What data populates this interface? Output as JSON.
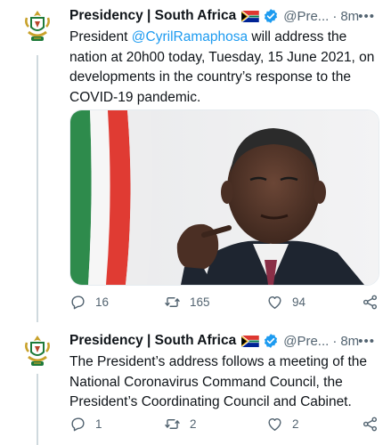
{
  "tweets": [
    {
      "author_name": "Presidency | South Africa",
      "handle": "@Pre...",
      "separator": "·",
      "time": "8m",
      "text_before": "President ",
      "mention": "@CyrilRamaphosa",
      "text_after": " will address the nation at 20h00 today, Tuesday, 15 June 2021, on developments in the country’s response to the COVID-19 pandemic.",
      "stats": {
        "replies": "16",
        "retweets": "165",
        "likes": "94"
      }
    },
    {
      "author_name": "Presidency | South Africa",
      "handle": "@Pre...",
      "separator": "·",
      "time": "8m",
      "text": "The President’s address follows a meeting of the National Coronavirus Command Council, the President’s Coordinating Council and Cabinet.",
      "stats": {
        "replies": "1",
        "retweets": "2",
        "likes": "2"
      }
    }
  ],
  "icons": [
    "coat-of-arms-icon",
    "south-africa-flag-icon",
    "verified-badge-icon",
    "more-options-icon",
    "reply-icon",
    "retweet-icon",
    "like-icon",
    "share-icon"
  ],
  "colors": {
    "accent": "#1d9bf0",
    "secondary_text": "#536471",
    "text": "#0f1419",
    "thread_line": "#cfd9de"
  }
}
